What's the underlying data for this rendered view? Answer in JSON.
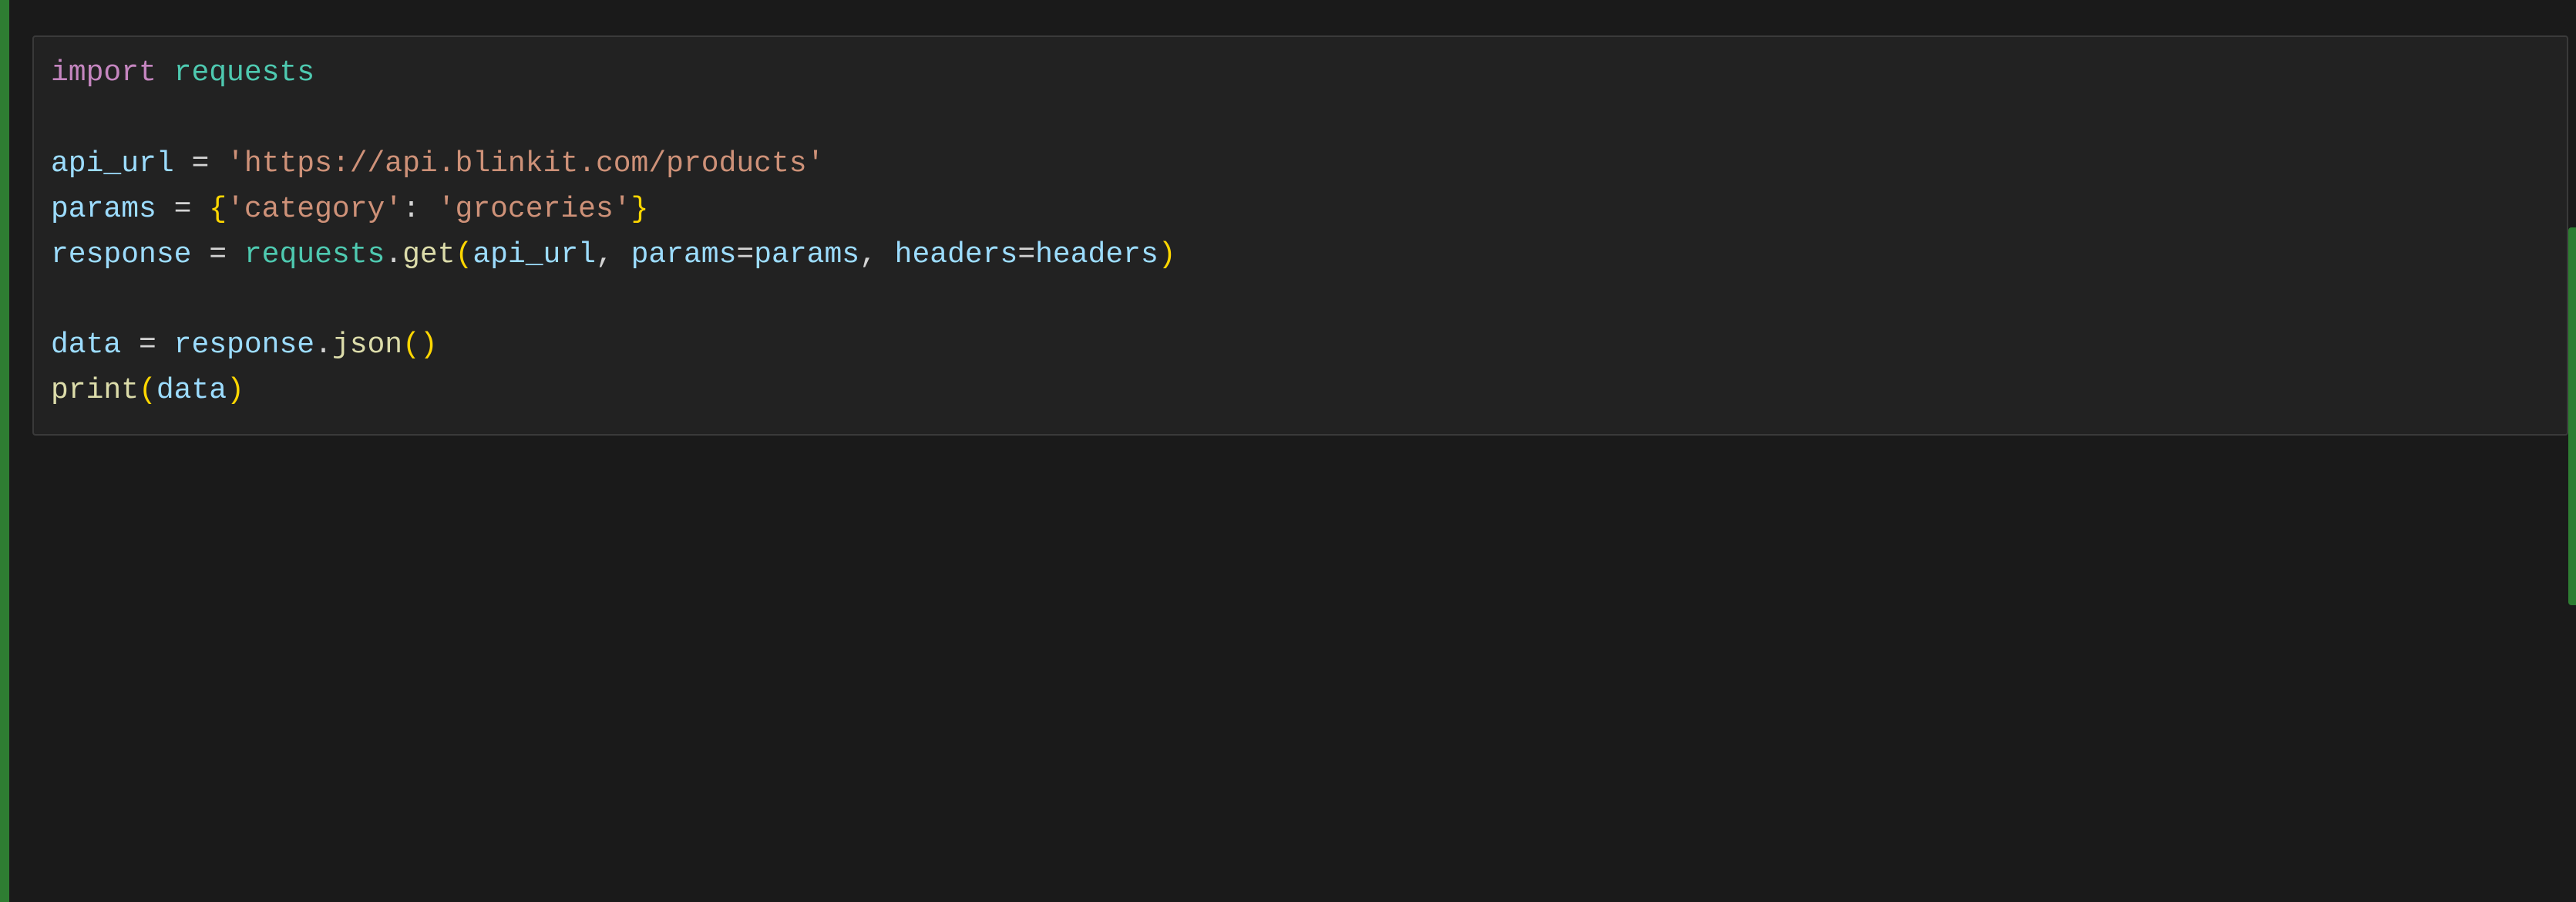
{
  "code": {
    "line1": {
      "kw_import": "import",
      "module": "requests"
    },
    "line3": {
      "var": "api_url",
      "eq": " = ",
      "str": "'https://api.blinkit.com/products'"
    },
    "line4": {
      "var": "params",
      "eq": " = ",
      "lbrace": "{",
      "key": "'category'",
      "colon": ": ",
      "val": "'groceries'",
      "rbrace": "}"
    },
    "line5": {
      "var": "response",
      "eq": " = ",
      "obj": "requests",
      "dot": ".",
      "fn": "get",
      "lp": "(",
      "arg1": "api_url",
      "c1": ", ",
      "kw1": "params",
      "eq1": "=",
      "kv1": "params",
      "c2": ", ",
      "kw2": "headers",
      "eq2": "=",
      "kv2": "headers",
      "rp": ")"
    },
    "line7": {
      "var": "data",
      "eq": " = ",
      "obj": "response",
      "dot": ".",
      "fn": "json",
      "lp": "(",
      "rp": ")"
    },
    "line8": {
      "fn": "print",
      "lp": "(",
      "arg": "data",
      "rp": ")"
    }
  }
}
